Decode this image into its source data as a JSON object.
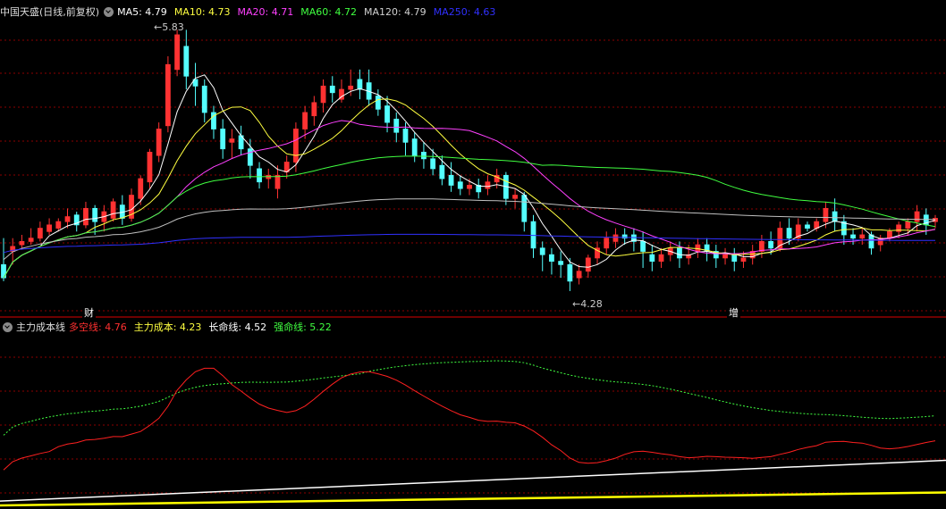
{
  "main_header": {
    "stock_title": "中国天盛(日线,前复权)",
    "ma5": "MA5: 4.79",
    "ma10": "MA10: 4.73",
    "ma20": "MA20: 4.71",
    "ma60": "MA60: 4.72",
    "ma120": "MA120: 4.79",
    "ma250": "MA250: 4.63"
  },
  "sub_header": {
    "indicator_name": "主力成本线",
    "duokong": "多空线: 4.76",
    "cost": "主力成本: 4.23",
    "changming": "长命线: 4.52",
    "qiangming": "强命线: 5.22"
  },
  "annotations": {
    "high_label": "5.83",
    "low_label": "4.28",
    "event_cai": "财",
    "event_zeng": "增"
  },
  "colors": {
    "up": "#ff3232",
    "down": "#54ffff",
    "ma5": "#ffffff",
    "ma10": "#ffff40",
    "ma20": "#ff40ff",
    "ma60": "#40ff40",
    "ma120": "#c0c0c0",
    "ma250": "#3030ff",
    "grid": "#8b0000"
  },
  "chart_data": {
    "type": "candlestick",
    "price_range": [
      4.15,
      5.9
    ],
    "candles": [
      [
        4.44,
        4.6,
        4.36,
        4.34
      ],
      [
        4.52,
        4.6,
        4.55,
        4.44
      ],
      [
        4.56,
        4.62,
        4.58,
        4.53
      ],
      [
        4.58,
        4.66,
        4.6,
        4.56
      ],
      [
        4.6,
        4.7,
        4.66,
        4.58
      ],
      [
        4.64,
        4.72,
        4.68,
        4.62
      ],
      [
        4.66,
        4.72,
        4.7,
        4.64
      ],
      [
        4.7,
        4.78,
        4.73,
        4.66
      ],
      [
        4.74,
        4.76,
        4.68,
        4.64
      ],
      [
        4.68,
        4.82,
        4.78,
        4.66
      ],
      [
        4.78,
        4.8,
        4.7,
        4.62
      ],
      [
        4.7,
        4.8,
        4.76,
        4.64
      ],
      [
        4.72,
        4.84,
        4.82,
        4.7
      ],
      [
        4.8,
        4.86,
        4.72,
        4.68
      ],
      [
        4.72,
        4.9,
        4.86,
        4.7
      ],
      [
        4.84,
        4.98,
        4.96,
        4.8
      ],
      [
        4.94,
        5.14,
        5.12,
        4.9
      ],
      [
        5.1,
        5.3,
        5.26,
        5.06
      ],
      [
        5.28,
        5.7,
        5.65,
        5.24
      ],
      [
        5.62,
        5.86,
        5.83,
        5.58
      ],
      [
        5.76,
        5.86,
        5.58,
        5.5
      ],
      [
        5.56,
        5.66,
        5.52,
        5.4
      ],
      [
        5.52,
        5.56,
        5.36,
        5.3
      ],
      [
        5.36,
        5.4,
        5.26,
        5.2
      ],
      [
        5.26,
        5.32,
        5.14,
        5.08
      ],
      [
        5.18,
        5.26,
        5.2,
        5.08
      ],
      [
        5.22,
        5.28,
        5.14,
        5.1
      ],
      [
        5.14,
        5.2,
        5.04,
        4.96
      ],
      [
        5.02,
        5.06,
        4.94,
        4.9
      ],
      [
        4.96,
        5.02,
        4.98,
        4.9
      ],
      [
        4.9,
        5.04,
        4.98,
        4.84
      ],
      [
        5.0,
        5.1,
        5.06,
        4.96
      ],
      [
        5.06,
        5.3,
        5.26,
        5.0
      ],
      [
        5.26,
        5.4,
        5.36,
        5.2
      ],
      [
        5.34,
        5.46,
        5.42,
        5.28
      ],
      [
        5.42,
        5.56,
        5.52,
        5.36
      ],
      [
        5.52,
        5.58,
        5.48,
        5.42
      ],
      [
        5.44,
        5.56,
        5.5,
        5.42
      ],
      [
        5.5,
        5.62,
        5.52,
        5.46
      ],
      [
        5.56,
        5.62,
        5.5,
        5.44
      ],
      [
        5.54,
        5.62,
        5.44,
        5.4
      ],
      [
        5.46,
        5.5,
        5.38,
        5.34
      ],
      [
        5.4,
        5.46,
        5.3,
        5.24
      ],
      [
        5.32,
        5.36,
        5.24,
        5.18
      ],
      [
        5.26,
        5.3,
        5.18,
        5.1
      ],
      [
        5.2,
        5.24,
        5.1,
        5.06
      ],
      [
        5.12,
        5.18,
        5.08,
        5.02
      ],
      [
        5.08,
        5.14,
        5.02,
        4.98
      ],
      [
        5.04,
        5.1,
        4.96,
        4.92
      ],
      [
        4.98,
        5.06,
        4.92,
        4.88
      ],
      [
        4.94,
        4.98,
        4.9,
        4.86
      ],
      [
        4.9,
        4.96,
        4.92,
        4.86
      ],
      [
        4.92,
        4.96,
        4.88,
        4.84
      ],
      [
        4.9,
        4.98,
        4.94,
        4.86
      ],
      [
        4.94,
        5.02,
        4.98,
        4.9
      ],
      [
        4.98,
        5.0,
        4.84,
        4.8
      ],
      [
        4.84,
        4.9,
        4.86,
        4.78
      ],
      [
        4.86,
        4.88,
        4.7,
        4.64
      ],
      [
        4.7,
        4.74,
        4.54,
        4.48
      ],
      [
        4.54,
        4.58,
        4.5,
        4.4
      ],
      [
        4.5,
        4.54,
        4.46,
        4.38
      ],
      [
        4.46,
        4.52,
        4.44,
        4.36
      ],
      [
        4.44,
        4.48,
        4.34,
        4.28
      ],
      [
        4.36,
        4.44,
        4.4,
        4.32
      ],
      [
        4.4,
        4.5,
        4.48,
        4.36
      ],
      [
        4.48,
        4.58,
        4.54,
        4.44
      ],
      [
        4.54,
        4.64,
        4.6,
        4.5
      ],
      [
        4.58,
        4.66,
        4.62,
        4.54
      ],
      [
        4.62,
        4.66,
        4.6,
        4.56
      ],
      [
        4.62,
        4.66,
        4.58,
        4.52
      ],
      [
        4.58,
        4.64,
        4.52,
        4.42
      ],
      [
        4.5,
        4.56,
        4.46,
        4.4
      ],
      [
        4.46,
        4.54,
        4.5,
        4.42
      ],
      [
        4.5,
        4.58,
        4.54,
        4.46
      ],
      [
        4.54,
        4.58,
        4.48,
        4.42
      ],
      [
        4.48,
        4.56,
        4.5,
        4.44
      ],
      [
        4.52,
        4.6,
        4.56,
        4.48
      ],
      [
        4.56,
        4.6,
        4.52,
        4.46
      ],
      [
        4.52,
        4.56,
        4.48,
        4.42
      ],
      [
        4.48,
        4.54,
        4.5,
        4.44
      ],
      [
        4.5,
        4.54,
        4.46,
        4.4
      ],
      [
        4.46,
        4.52,
        4.48,
        4.42
      ],
      [
        4.48,
        4.56,
        4.52,
        4.44
      ],
      [
        4.52,
        4.62,
        4.58,
        4.48
      ],
      [
        4.58,
        4.64,
        4.54,
        4.5
      ],
      [
        4.54,
        4.7,
        4.66,
        4.52
      ],
      [
        4.66,
        4.72,
        4.6,
        4.56
      ],
      [
        4.6,
        4.72,
        4.68,
        4.58
      ],
      [
        4.68,
        4.7,
        4.66,
        4.64
      ],
      [
        4.66,
        4.72,
        4.7,
        4.64
      ],
      [
        4.7,
        4.82,
        4.78,
        4.66
      ],
      [
        4.76,
        4.84,
        4.7,
        4.64
      ],
      [
        4.7,
        4.74,
        4.62,
        4.56
      ],
      [
        4.62,
        4.66,
        4.6,
        4.56
      ],
      [
        4.6,
        4.66,
        4.62,
        4.56
      ],
      [
        4.62,
        4.64,
        4.54,
        4.5
      ],
      [
        4.56,
        4.62,
        4.6,
        4.52
      ],
      [
        4.6,
        4.66,
        4.64,
        4.58
      ],
      [
        4.64,
        4.7,
        4.68,
        4.6
      ],
      [
        4.66,
        4.72,
        4.7,
        4.62
      ],
      [
        4.7,
        4.8,
        4.76,
        4.64
      ],
      [
        4.74,
        4.78,
        4.68,
        4.62
      ],
      [
        4.7,
        4.74,
        4.72,
        4.66
      ]
    ],
    "sub_range": [
      3.9,
      5.9
    ]
  }
}
